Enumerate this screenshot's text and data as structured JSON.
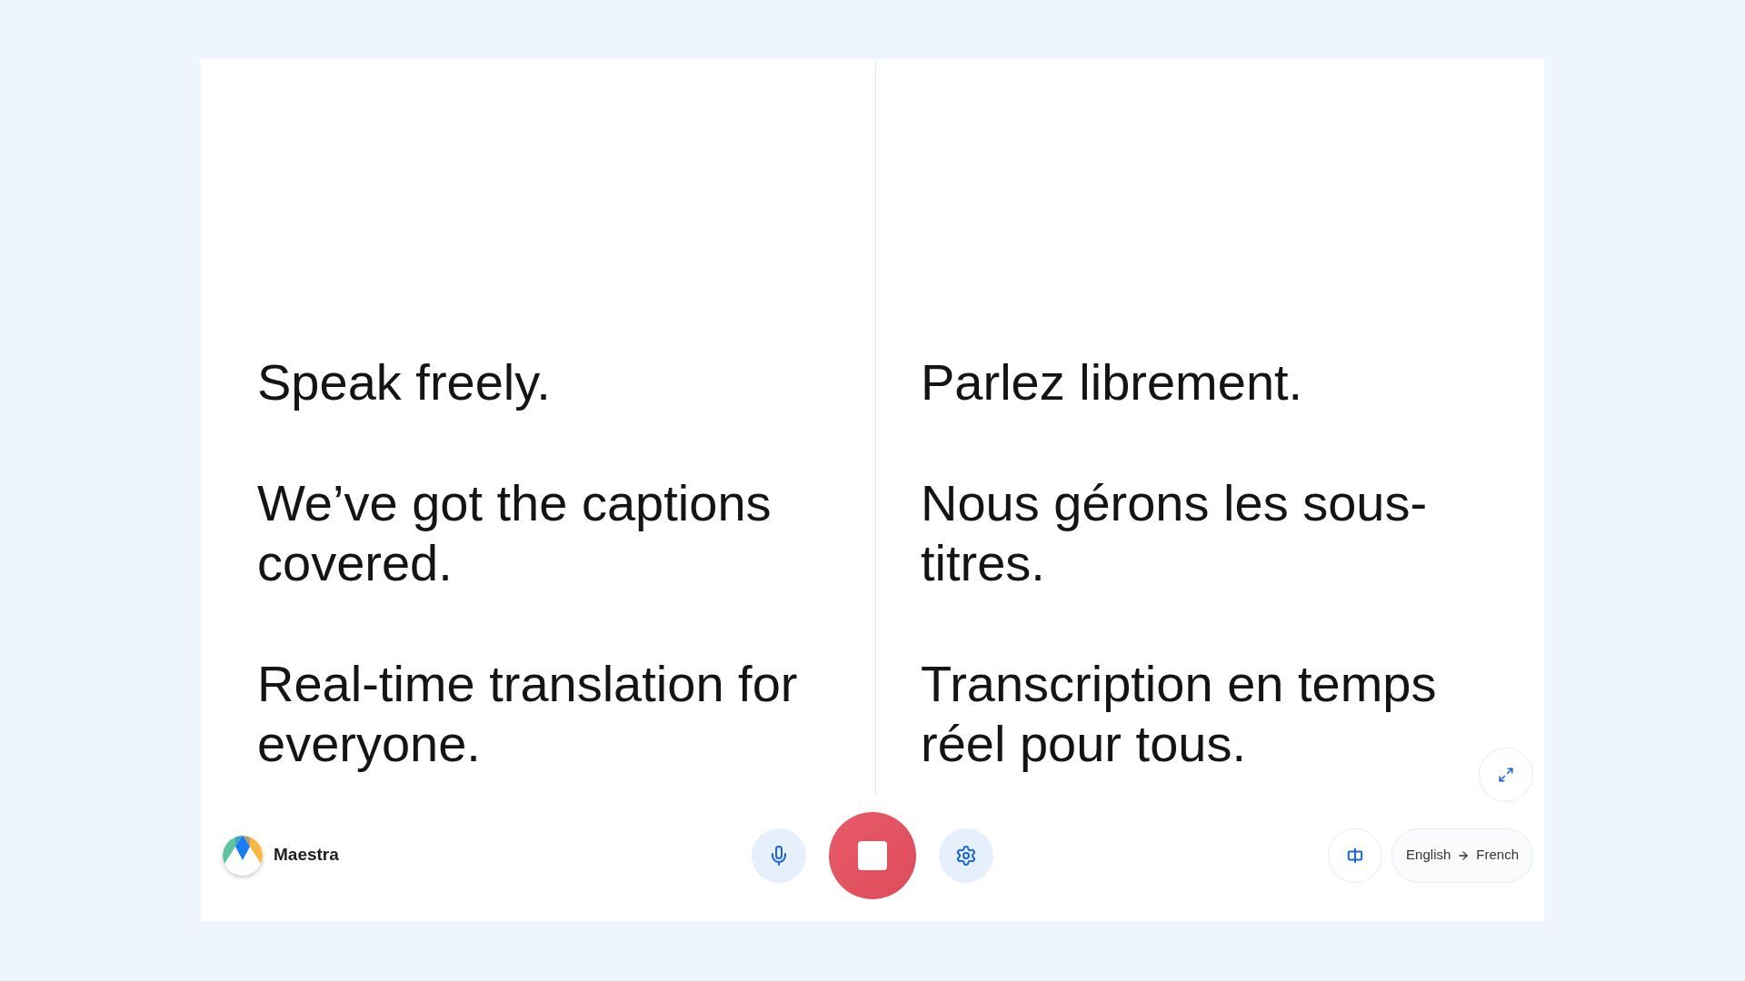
{
  "brand": {
    "name": "Maestra"
  },
  "captions": [
    {
      "kind": "source",
      "paragraphs": [
        "Speak freely.",
        "We’ve got the captions covered.",
        "Real-time translation for everyone."
      ]
    },
    {
      "kind": "translation",
      "paragraphs": [
        "Parlez librement.",
        "Nous gérons les sous-titres.",
        "Transcription en temps réel pour tous."
      ]
    }
  ],
  "session": {
    "recording": true
  },
  "language_pair": {
    "source": "English",
    "target": "French"
  }
}
